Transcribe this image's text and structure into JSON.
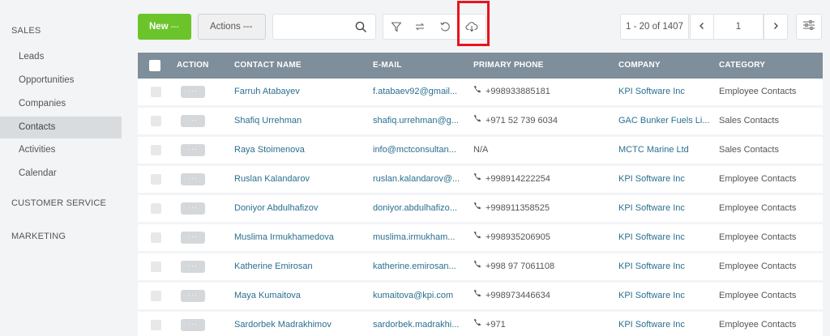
{
  "sidebar": {
    "sections": [
      "SALES",
      "CUSTOMER SERVICE",
      "MARKETING"
    ],
    "sales_items": [
      "Leads",
      "Opportunities",
      "Companies",
      "Contacts",
      "Activities",
      "Calendar"
    ],
    "active_item": "Contacts"
  },
  "toolbar": {
    "new_label": "New",
    "new_dots": "---",
    "actions_label": "Actions ---",
    "search_placeholder": "",
    "icons": [
      "search-icon",
      "filter-icon",
      "swap-icon",
      "refresh-icon",
      "cloud-download-icon"
    ],
    "highlighted_icon": "cloud-download-icon"
  },
  "pager": {
    "range_text": "1 - 20 of 1407",
    "page_value": "1"
  },
  "table": {
    "headers": {
      "action": "ACTION",
      "name": "CONTACT NAME",
      "email": "E-MAIL",
      "phone": "PRIMARY PHONE",
      "company": "COMPANY",
      "category": "CATEGORY"
    },
    "action_dots": "···",
    "rows": [
      {
        "name": "Farruh Atabayev",
        "email": "f.atabaev92@gmail...",
        "phone": "+998933885181",
        "phone_icon": true,
        "company": "KPI Software Inc",
        "category": "Employee Contacts"
      },
      {
        "name": "Shafiq Urrehman",
        "email": "shafiq.urrehman@g...",
        "phone": "+971 52 739 6034",
        "phone_icon": true,
        "company": "GAC Bunker Fuels Li...",
        "category": "Sales Contacts"
      },
      {
        "name": "Raya Stoimenova",
        "email": "info@mctconsultan...",
        "phone": "N/A",
        "phone_icon": false,
        "company": "MCTC Marine Ltd",
        "category": "Sales Contacts"
      },
      {
        "name": "Ruslan Kalandarov",
        "email": "ruslan.kalandarov@...",
        "phone": "+998914222254",
        "phone_icon": true,
        "company": "KPI Software Inc",
        "category": "Employee Contacts"
      },
      {
        "name": "Doniyor Abdulhafizov",
        "email": "doniyor.abdulhafizo...",
        "phone": "+998911358525",
        "phone_icon": true,
        "company": "KPI Software Inc",
        "category": "Employee Contacts"
      },
      {
        "name": "Muslima Irmukhamedova",
        "email": "muslima.irmukham...",
        "phone": "+998935206905",
        "phone_icon": true,
        "company": "KPI Software Inc",
        "category": "Employee Contacts"
      },
      {
        "name": "Katherine Emirosan",
        "email": "katherine.emirosan...",
        "phone": "+998 97 7061108",
        "phone_icon": true,
        "company": "KPI Software Inc",
        "category": "Employee Contacts"
      },
      {
        "name": "Maya Kumaitova",
        "email": "kumaitova@kpi.com",
        "phone": "+998973446634",
        "phone_icon": true,
        "company": "KPI Software Inc",
        "category": "Employee Contacts"
      },
      {
        "name": "Sardorbek Madrakhimov",
        "email": "sardorbek.madrakhi...",
        "phone": "+971",
        "phone_icon": true,
        "company": "KPI Software Inc",
        "category": "Employee Contacts"
      }
    ]
  },
  "colors": {
    "new_button": "#6cc42b",
    "table_header": "#7e8e9b",
    "link": "#2a6f8f",
    "highlight": "#e8141d"
  }
}
